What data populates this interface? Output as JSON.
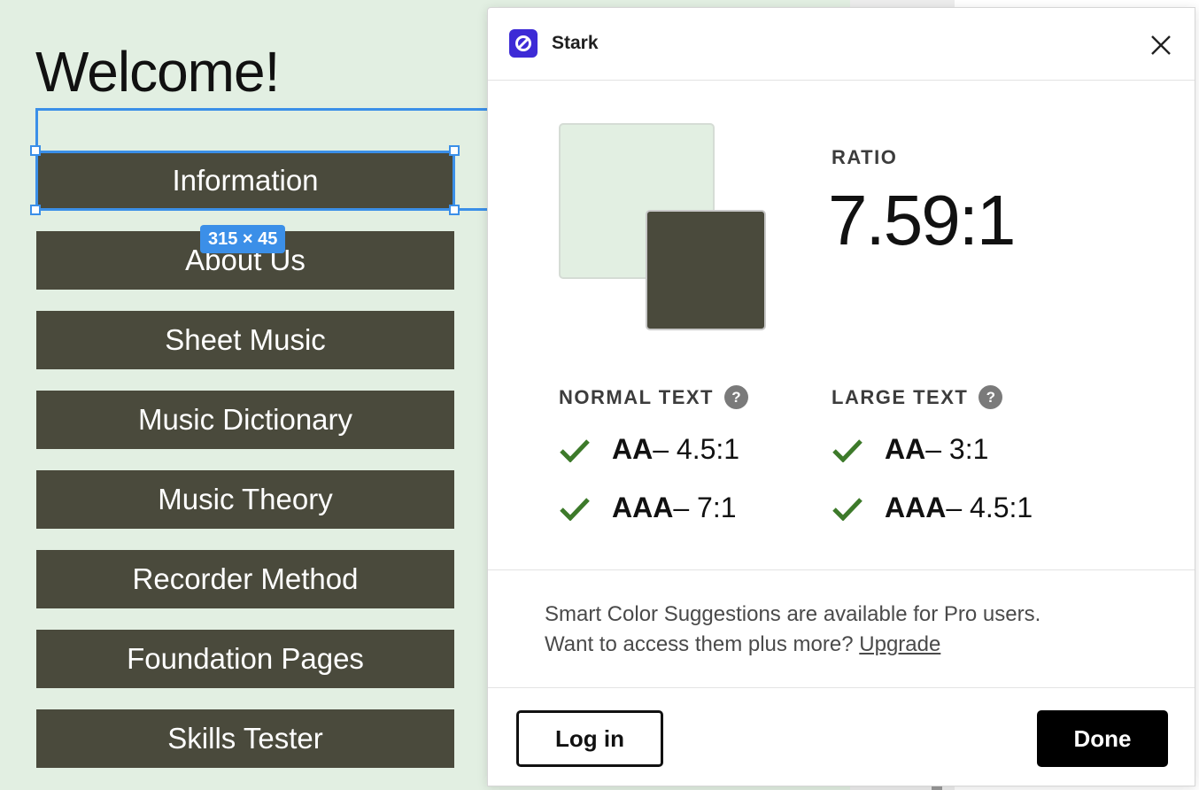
{
  "canvas": {
    "heading": "Welcome!",
    "nav_buttons": [
      "Information",
      "About Us",
      "Sheet Music",
      "Music Dictionary",
      "Music Theory",
      "Recorder Method",
      "Foundation Pages",
      "Skills Tester"
    ],
    "selection_size": "315 × 45"
  },
  "dialog": {
    "app_name": "Stark",
    "ratio_label": "RATIO",
    "ratio_value": "7.59:1",
    "background_color": "#e2efe2",
    "foreground_color": "#4a4a3c",
    "normal_text": {
      "title": "NORMAL TEXT",
      "checks": [
        {
          "level": "AA",
          "requirement": " – 4.5:1",
          "status": "pass"
        },
        {
          "level": "AAA",
          "requirement": " – 7:1",
          "status": "pass"
        }
      ]
    },
    "large_text": {
      "title": "LARGE TEXT",
      "checks": [
        {
          "level": "AA",
          "requirement": " – 3:1",
          "status": "pass"
        },
        {
          "level": "AAA",
          "requirement": " – 4.5:1",
          "status": "pass"
        }
      ]
    },
    "promo_line1": "Smart Color Suggestions are available for Pro users.",
    "promo_line2": "Want to access them plus more? ",
    "upgrade_link": "Upgrade",
    "login_label": "Log in",
    "done_label": "Done"
  },
  "colors": {
    "canvas_bg": "#e2efe2",
    "button_bg": "#4a4a3c",
    "selection_blue": "#3b8fe8",
    "pass_green": "#3d7a2a",
    "stark_purple": "#3d2bd6"
  },
  "icons": {
    "logo": "stark-logo-icon",
    "close": "close-icon",
    "help": "help-circle-icon",
    "check": "check-icon"
  }
}
